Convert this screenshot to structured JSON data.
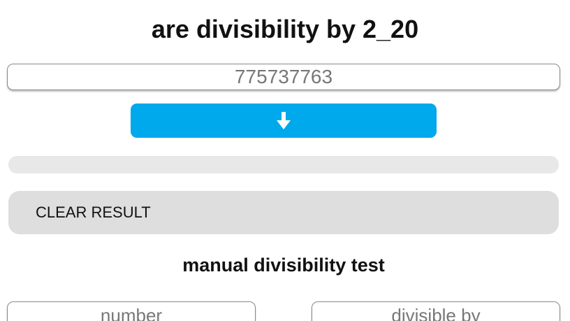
{
  "header": {
    "title": "are divisibility by 2_20"
  },
  "main_input": {
    "value": "775737763"
  },
  "run_button": {
    "icon": "arrow-down-icon"
  },
  "progress": {
    "fraction": 0
  },
  "clear_button": {
    "label": "CLEAR RESULT"
  },
  "manual_test": {
    "title": "manual divisibility test",
    "number_placeholder": "number",
    "divisor_placeholder": "divisible by"
  },
  "colors": {
    "accent": "#00a8ec",
    "panel": "#dedede",
    "track": "#e8e8e8"
  }
}
